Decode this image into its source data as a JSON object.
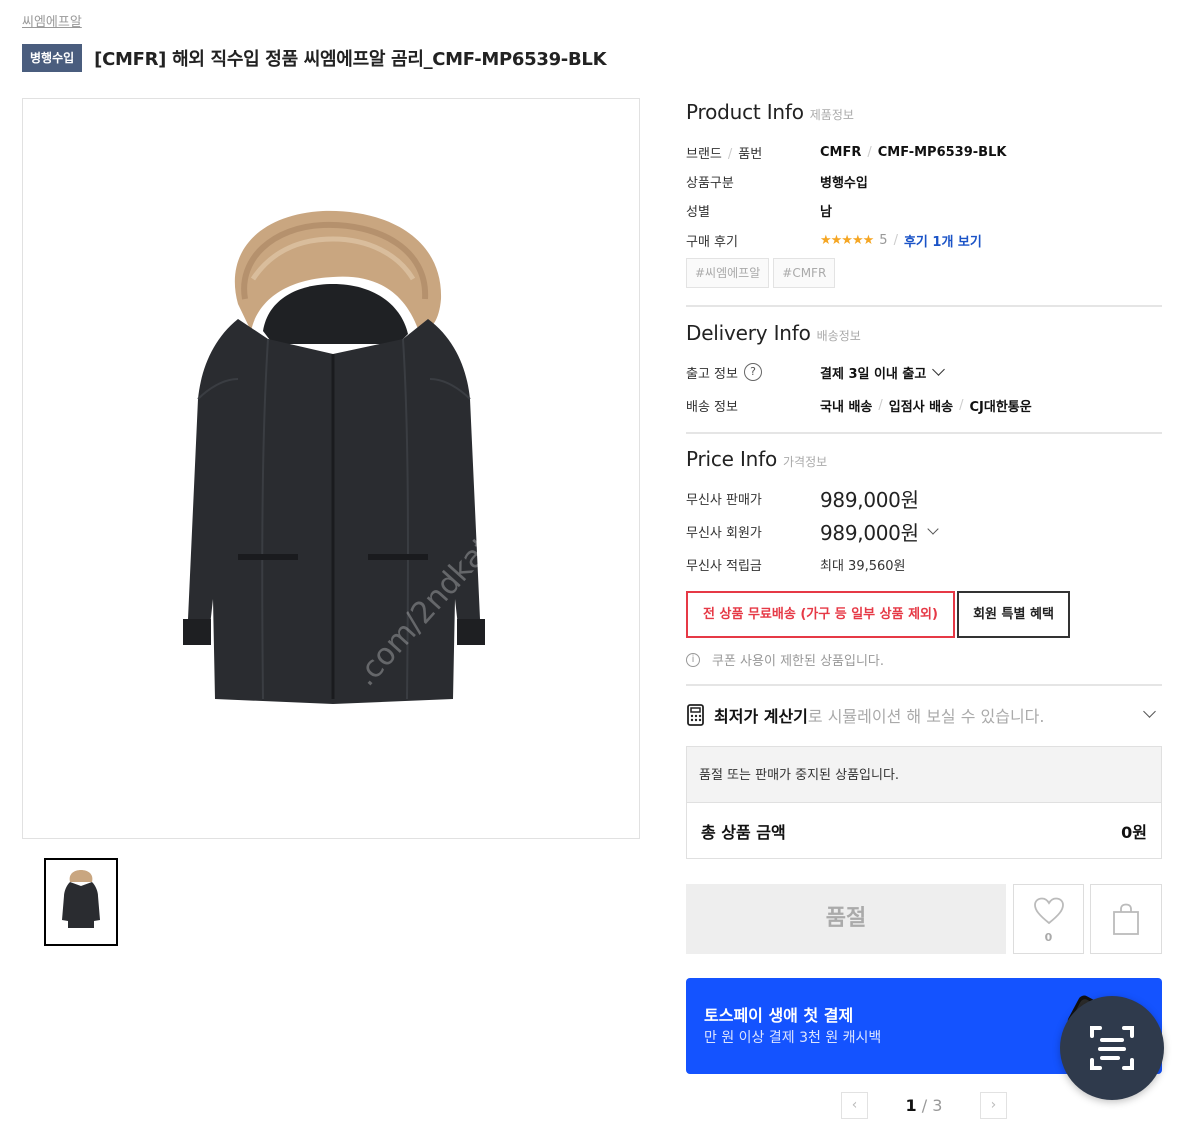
{
  "breadcrumb": "씨엠에프알",
  "product": {
    "badge": "병행수입",
    "title": "[CMFR] 해외 직수입 정품 씨엠에프알 곰리_CMF-MP6539-BLK",
    "watermark": ".com/2ndkatsuma"
  },
  "product_info": {
    "title": "Product Info",
    "subtitle": "제품정보",
    "brand_label": "브랜드",
    "product_no_label": "품번",
    "brand": "CMFR",
    "product_no": "CMF-MP6539-BLK",
    "category_label": "상품구분",
    "category": "병행수입",
    "gender_label": "성별",
    "gender": "남",
    "review_label": "구매 후기",
    "stars": "★★★★★",
    "rating": "5",
    "review_link": "후기 1개 보기",
    "tags": [
      "#씨엠에프알",
      "#CMFR"
    ]
  },
  "delivery_info": {
    "title": "Delivery Info",
    "subtitle": "배송정보",
    "release_label": "출고 정보",
    "release_value": "결제 3일 이내 출고",
    "shipping_label": "배송 정보",
    "shipping_1": "국내 배송",
    "shipping_2": "입점사 배송",
    "shipping_3": "CJ대한통운"
  },
  "price_info": {
    "title": "Price Info",
    "subtitle": "가격정보",
    "sale_label": "무신사 판매가",
    "sale_price": "989,000원",
    "member_label": "무신사 회원가",
    "member_price": "989,000원",
    "points_label": "무신사 적립금",
    "points_value": "최대 39,560원"
  },
  "buttons": {
    "free_shipping": "전 상품 무료배송 (가구 등 일부 상품 제외)",
    "member_benefit": "회원 특별 혜택",
    "soldout": "품절",
    "like_count": "0"
  },
  "coupon_notice": "쿠폰 사용이 제한된 상품입니다.",
  "calculator": {
    "strong": "최저가 계산기",
    "rest": "로 시뮬레이션 해 보실 수 있습니다."
  },
  "soldout_message": "품절 또는 판매가 중지된 상품입니다.",
  "total": {
    "label": "총 상품 금액",
    "value": "0원"
  },
  "promo": {
    "title": "토스페이 생애 첫 결제",
    "subtitle": "만 원 이상 결제 3천 원 캐시백"
  },
  "pager": {
    "current": "1",
    "total": "3"
  }
}
